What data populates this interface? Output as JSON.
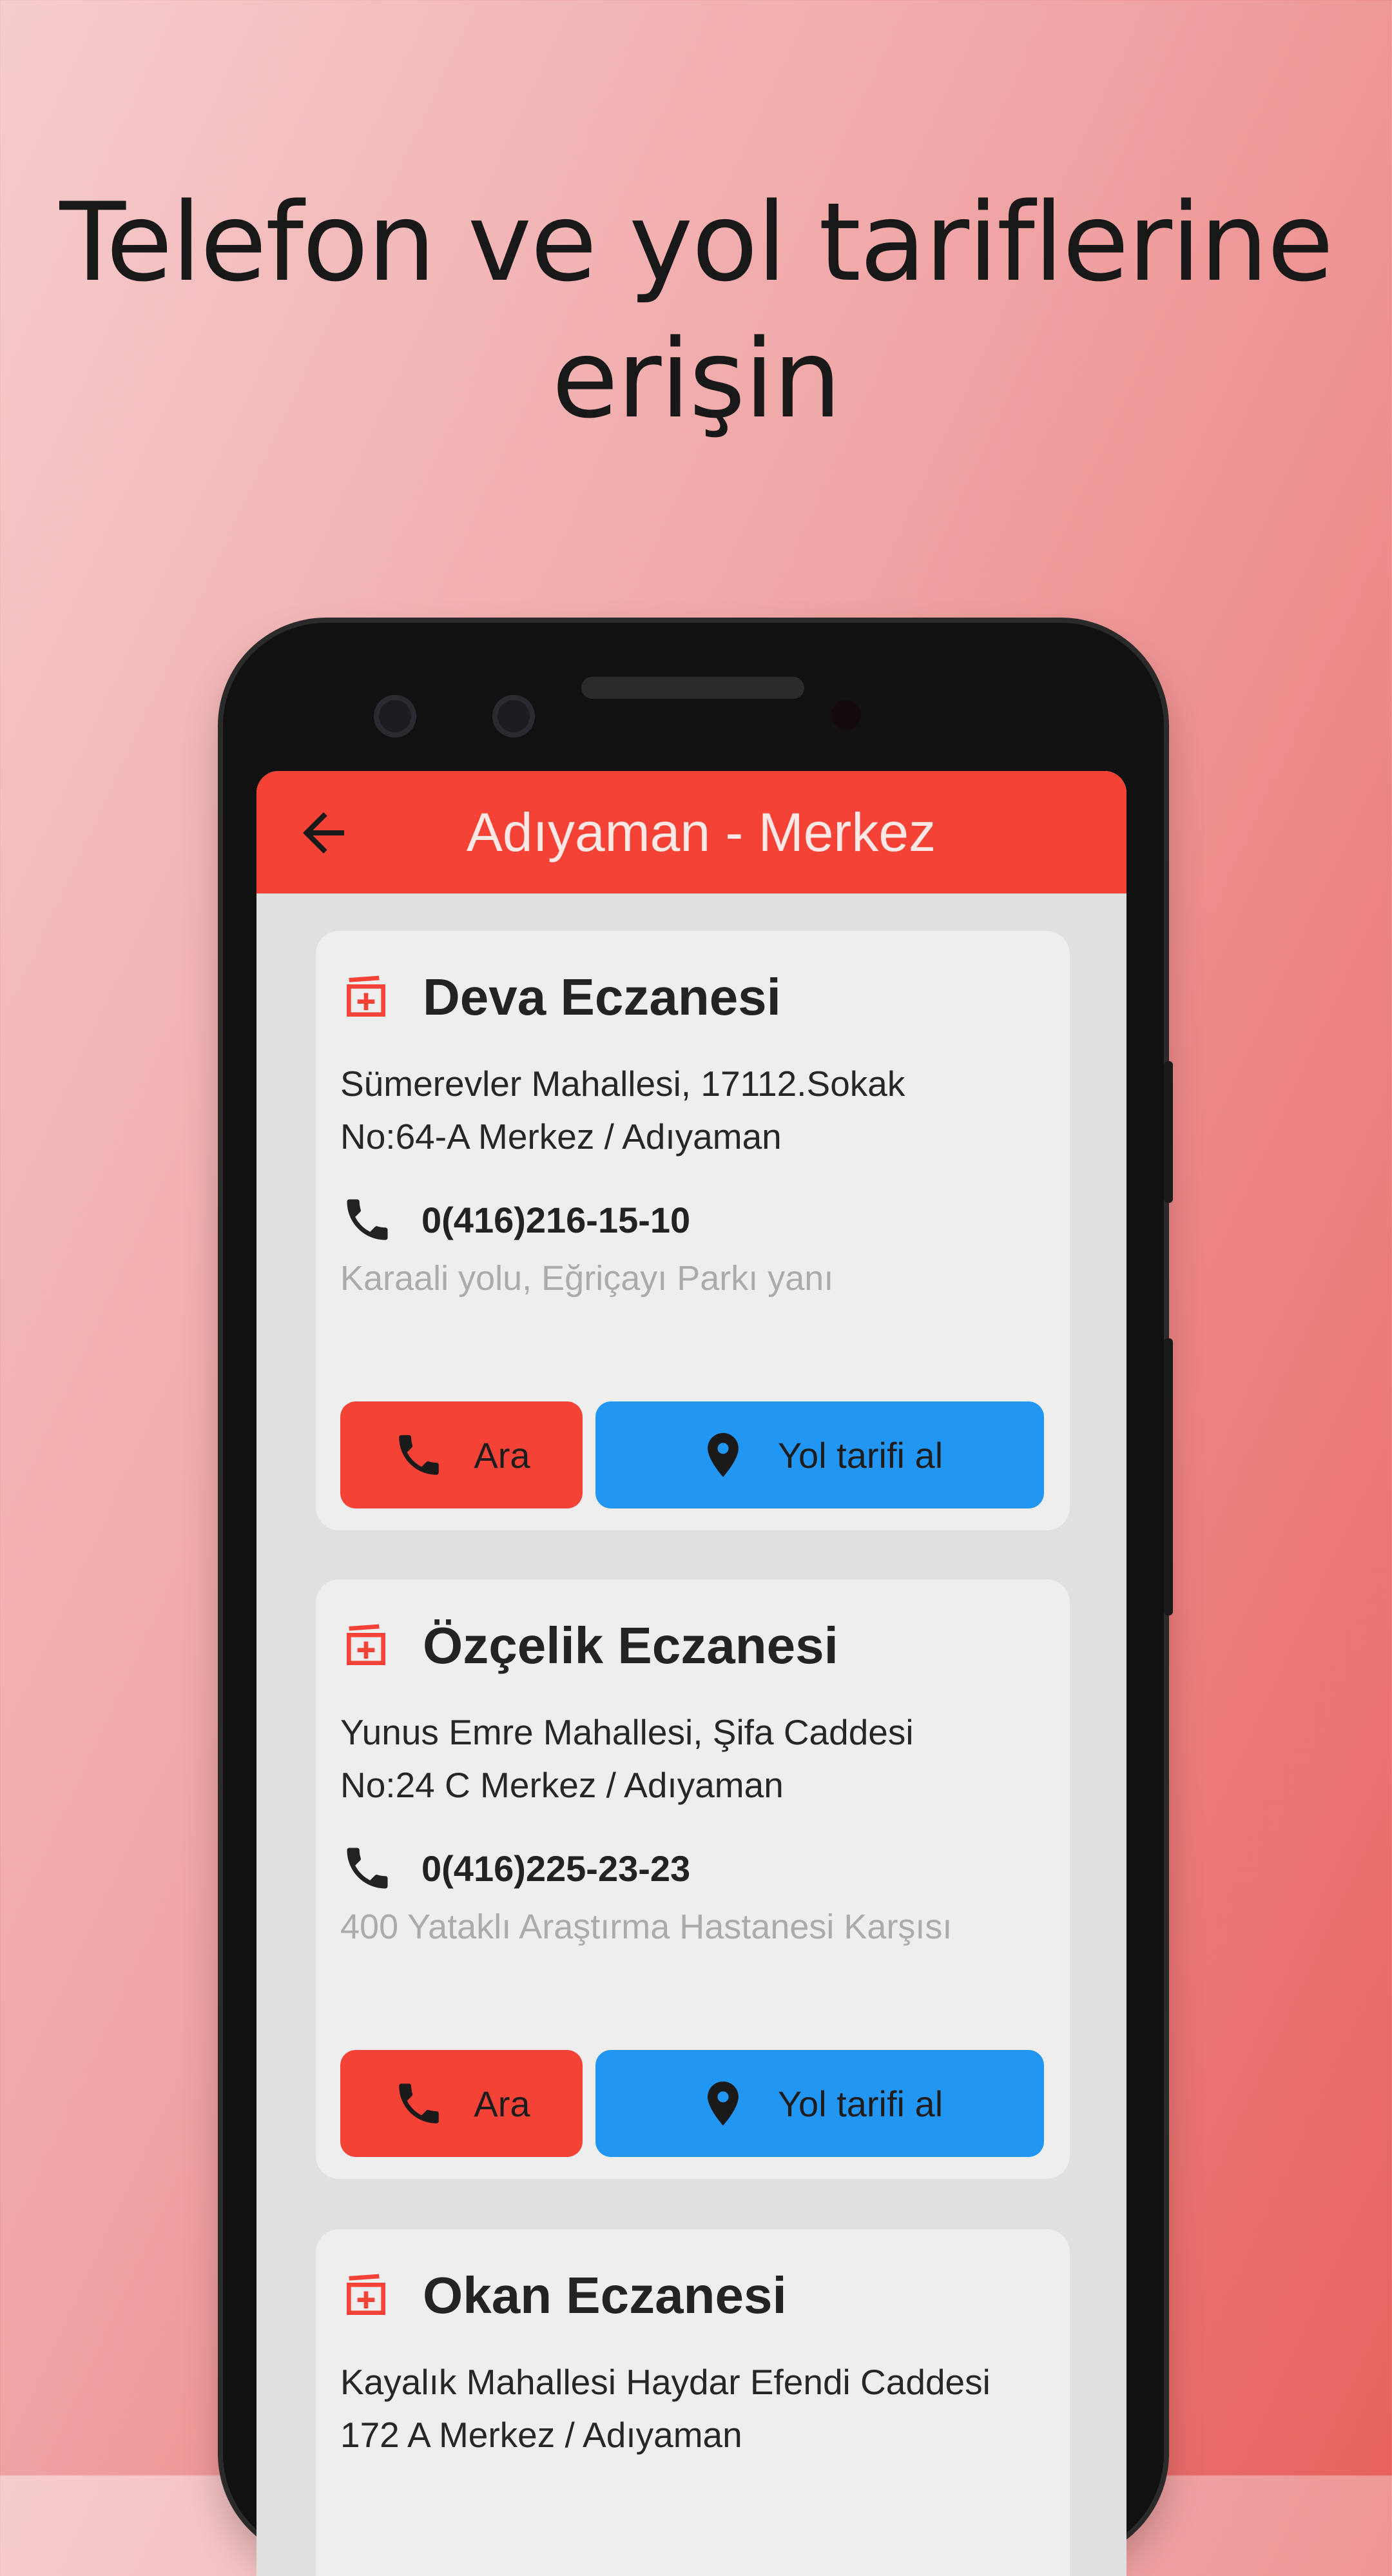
{
  "headline": {
    "line1": "Telefon ve yol tariflerine",
    "line2": "erişin"
  },
  "appbar": {
    "title": "Adıyaman - Merkez",
    "back_icon": "arrow-back-icon"
  },
  "colors": {
    "accent": "#f44336",
    "action_blue": "#2196f3",
    "card_bg": "#eeeeee"
  },
  "pharmacies": [
    {
      "name": "Deva Eczanesi",
      "address_line1": "Sümerevler Mahallesi, 17112.Sokak",
      "address_line2": "No:64-A Merkez / Adıyaman",
      "phone": "0(416)216-15-10",
      "note": "Karaali yolu, Eğriçayı Parkı yanı",
      "call_label": "Ara",
      "directions_label": "Yol tarifi al"
    },
    {
      "name": "Özçelik Eczanesi",
      "address_line1": "Yunus Emre Mahallesi, Şifa Caddesi",
      "address_line2": "No:24 C Merkez / Adıyaman",
      "phone": "0(416)225-23-23",
      "note": "400 Yataklı Araştırma Hastanesi Karşısı",
      "call_label": "Ara",
      "directions_label": "Yol tarifi al"
    },
    {
      "name": "Okan Eczanesi",
      "address_line1": "Kayalık Mahallesi Haydar Efendi Caddesi",
      "address_line2": "172 A Merkez / Adıyaman"
    }
  ]
}
